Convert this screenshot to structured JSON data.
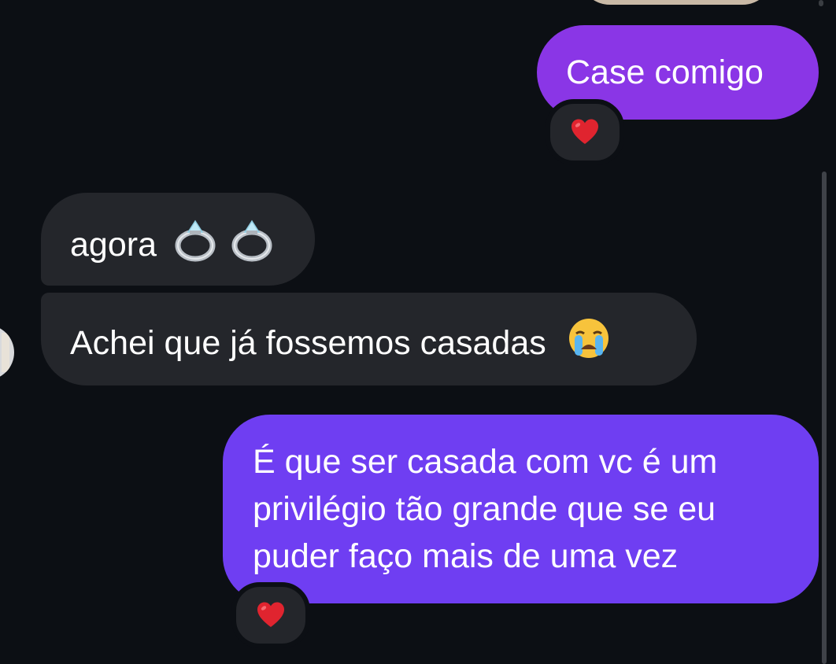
{
  "messages": [
    {
      "id": "m1",
      "direction": "sent",
      "text": "Case comigo",
      "reaction": "heart-icon"
    },
    {
      "id": "m2",
      "direction": "received",
      "text": "agora",
      "emojis": [
        "ring-icon",
        "ring-icon"
      ]
    },
    {
      "id": "m3",
      "direction": "received",
      "text": "Achei que já fossemos casadas",
      "emojis": [
        "crying-face-icon"
      ]
    },
    {
      "id": "m4",
      "direction": "sent",
      "lines": [
        "É que ser casada com vc é um",
        "privilégio tão grande que se eu",
        "puder faço mais de uma vez"
      ],
      "reaction": "heart-icon"
    }
  ],
  "colors": {
    "background": "#0c0f14",
    "sent_bubble": "#7d3cf0",
    "received_bubble": "#24262b",
    "reaction_background": "#24262b",
    "heart": "#e0242f"
  }
}
